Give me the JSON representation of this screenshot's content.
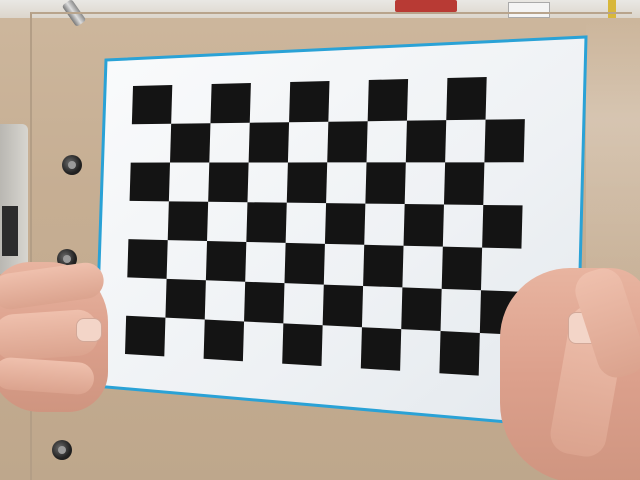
{
  "scene": {
    "description_label": "",
    "colors": {
      "background_wood": "#c6ae93",
      "panel_border": "#2aa2d6",
      "panel_face": "#f2f4f7",
      "checker_dark": "#141414",
      "skin": "#e2aa95"
    },
    "icons": [
      "bolt-icon",
      "pen-icon"
    ],
    "checkerboard": {
      "rows": 7,
      "cols": 10
    }
  }
}
